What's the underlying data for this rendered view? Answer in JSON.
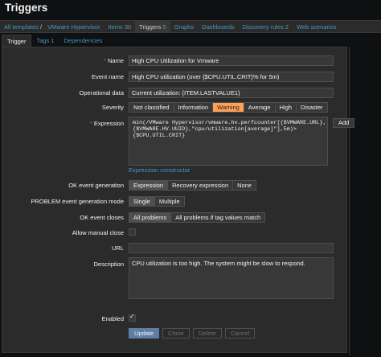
{
  "page_title": "Triggers",
  "breadcrumbs": [
    {
      "label": "All templates"
    },
    {
      "label": "VMware Hypervisor"
    },
    {
      "label": "Items",
      "count": "30"
    },
    {
      "label": "Triggers",
      "count": "5"
    },
    {
      "label": "Graphs"
    },
    {
      "label": "Dashboards"
    },
    {
      "label": "Discovery rules",
      "count": "2"
    },
    {
      "label": "Web scenarios"
    }
  ],
  "breadcrumb_separator": "/",
  "tabs": [
    {
      "label": "Trigger"
    },
    {
      "label": "Tags",
      "count": "1"
    },
    {
      "label": "Dependencies"
    }
  ],
  "form": {
    "name": {
      "label": "Name",
      "value": "High CPU Utilization for Vmware"
    },
    "event_name": {
      "label": "Event name",
      "value": "High CPU utilization (over {$CPU.UTIL.CRIT}% for 5m)"
    },
    "operational_data": {
      "label": "Operational data",
      "value": "Current utilization: {ITEM.LASTVALUE1}"
    },
    "severity": {
      "label": "Severity",
      "options": [
        "Not classified",
        "Information",
        "Warning",
        "Average",
        "High",
        "Disaster"
      ],
      "selected": "Warning"
    },
    "expression": {
      "label": "Expression",
      "value": "min(/VMware Hypervisor/vmware.hv.perfcounter[{$VMWARE.URL},\n{$VMWARE.HV.UUID},\"cpu/utilization[average]\"],5m)>\n{$CPU.UTIL.CRIT}",
      "add_label": "Add",
      "constructor_link": "Expression constructor"
    },
    "ok_event_generation": {
      "label": "OK event generation",
      "options": [
        "Expression",
        "Recovery expression",
        "None"
      ],
      "selected": "Expression"
    },
    "problem_event_mode": {
      "label": "PROBLEM event generation mode",
      "options": [
        "Single",
        "Multiple"
      ],
      "selected": "Single"
    },
    "ok_event_closes": {
      "label": "OK event closes",
      "options": [
        "All problems",
        "All problems if tag values match"
      ],
      "selected": "All problems"
    },
    "allow_manual_close": {
      "label": "Allow manual close",
      "checked": false
    },
    "url": {
      "label": "URL",
      "value": ""
    },
    "description": {
      "label": "Description",
      "value": "CPU utilization is too high. The system might be slow to respond."
    },
    "enabled": {
      "label": "Enabled",
      "checked": true
    }
  },
  "buttons": {
    "update": "Update",
    "clone": "Clone",
    "delete": "Delete",
    "cancel": "Cancel"
  },
  "colors": {
    "accent_link": "#4796c4",
    "warning": "#ffa059",
    "primary_button": "#5e7ea2",
    "required": "#e45959"
  }
}
